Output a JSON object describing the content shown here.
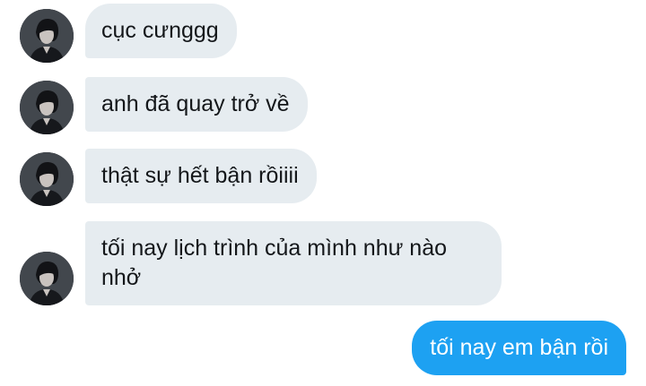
{
  "conversation": {
    "received": [
      {
        "text": "cục cưnggg"
      },
      {
        "text": "anh đã quay trở về"
      },
      {
        "text": "thật sự hết bận rồiiii"
      },
      {
        "text": "tối nay lịch trình của mình như nào nhở"
      }
    ],
    "sent": [
      {
        "text": "tối nay em bận rồi"
      }
    ]
  },
  "colors": {
    "received_bubble": "#e6ecf0",
    "sent_bubble": "#1da1f2",
    "text_dark": "#14171a",
    "text_light": "#ffffff"
  },
  "icons": {
    "avatar": "user-avatar-photo"
  }
}
